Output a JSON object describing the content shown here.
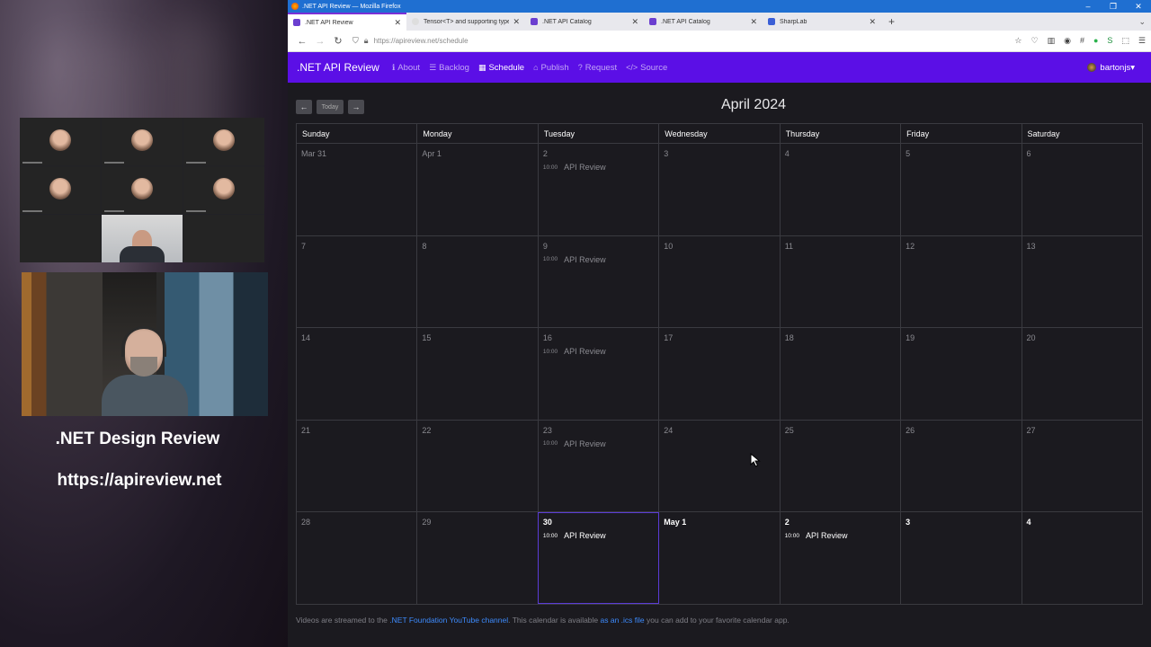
{
  "stream": {
    "title": ".NET Design Review",
    "url": "https://apireview.net"
  },
  "browser": {
    "window_title": ".NET API Review — Mozilla Firefox",
    "tabs": [
      {
        "label": ".NET API Review",
        "icon": "api-review-icon"
      },
      {
        "label": "Tensor<T> and supporting types",
        "icon": "blank-page-icon"
      },
      {
        "label": ".NET API Catalog",
        "icon": "api-catalog-icon"
      },
      {
        "label": ".NET API Catalog",
        "icon": "api-catalog-icon"
      },
      {
        "label": "SharpLab",
        "icon": "sharplab-icon"
      }
    ],
    "address": "https://apireview.net/schedule"
  },
  "app": {
    "brand": ".NET API Review",
    "nav": [
      {
        "label": "About",
        "icon": "info-icon"
      },
      {
        "label": "Backlog",
        "icon": "list-icon"
      },
      {
        "label": "Schedule",
        "icon": "calendar-icon"
      },
      {
        "label": "Publish",
        "icon": "inbox-icon"
      },
      {
        "label": "Request",
        "icon": "question-icon"
      },
      {
        "label": "Source",
        "icon": "code-icon"
      }
    ],
    "user": "bartonjs",
    "colors": {
      "navbar": "#5b0fe6",
      "link": "#3d8bfd"
    }
  },
  "calendar": {
    "prev": "←",
    "today": "Today",
    "next": "→",
    "month": "April 2024",
    "weekdays": [
      "Sunday",
      "Monday",
      "Tuesday",
      "Wednesday",
      "Thursday",
      "Friday",
      "Saturday"
    ],
    "weeks": [
      [
        {
          "day": "Mar 31"
        },
        {
          "day": "Apr 1"
        },
        {
          "day": "2",
          "event": {
            "time": "10:00",
            "name": "API Review"
          }
        },
        {
          "day": "3"
        },
        {
          "day": "4"
        },
        {
          "day": "5"
        },
        {
          "day": "6"
        }
      ],
      [
        {
          "day": "7"
        },
        {
          "day": "8"
        },
        {
          "day": "9",
          "event": {
            "time": "10:00",
            "name": "API Review"
          }
        },
        {
          "day": "10"
        },
        {
          "day": "11"
        },
        {
          "day": "12"
        },
        {
          "day": "13"
        }
      ],
      [
        {
          "day": "14"
        },
        {
          "day": "15"
        },
        {
          "day": "16",
          "event": {
            "time": "10:00",
            "name": "API Review"
          }
        },
        {
          "day": "17"
        },
        {
          "day": "18"
        },
        {
          "day": "19"
        },
        {
          "day": "20"
        }
      ],
      [
        {
          "day": "21"
        },
        {
          "day": "22"
        },
        {
          "day": "23",
          "event": {
            "time": "10:00",
            "name": "API Review"
          }
        },
        {
          "day": "24"
        },
        {
          "day": "25"
        },
        {
          "day": "26"
        },
        {
          "day": "27"
        }
      ],
      [
        {
          "day": "28"
        },
        {
          "day": "29"
        },
        {
          "day": "30",
          "current": true,
          "today": true,
          "event": {
            "time": "10:00",
            "name": "API Review"
          }
        },
        {
          "day": "May 1",
          "current": true
        },
        {
          "day": "2",
          "current": true,
          "event": {
            "time": "10:00",
            "name": "API Review"
          }
        },
        {
          "day": "3",
          "current": true
        },
        {
          "day": "4",
          "current": true
        }
      ]
    ]
  },
  "footer": {
    "prefix": "Videos are streamed to the ",
    "channel_link": ".NET Foundation YouTube channel",
    "middle": ". This calendar is available ",
    "ics_link": "as an .ics file",
    "suffix": " you can add to your favorite calendar app."
  }
}
